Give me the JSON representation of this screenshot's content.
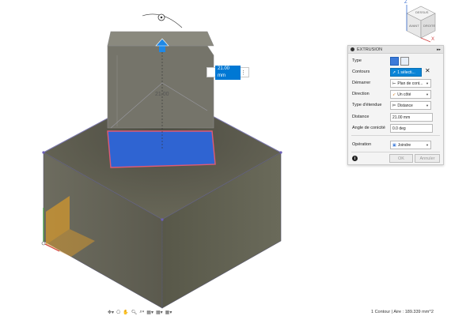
{
  "viewport": {
    "dimension_value": "21.00 mm",
    "dimension_label": "21.00",
    "viewcube": {
      "top": "DESSUS",
      "front": "AVANT",
      "right": "DROITE",
      "axis_x": "X",
      "axis_z": "Z"
    }
  },
  "panel": {
    "title": "EXTRUSION",
    "rows": {
      "type": {
        "label": "Type"
      },
      "profiles": {
        "label": "Contours",
        "value": "1 sélecti..."
      },
      "start": {
        "label": "Démarrer",
        "value": "Plan de cont..."
      },
      "direction": {
        "label": "Direction",
        "value": "Un côté"
      },
      "extent_type": {
        "label": "Type d'étendue",
        "value": "Distance"
      },
      "distance": {
        "label": "Distance",
        "value": "21.00 mm"
      },
      "taper": {
        "label": "Angle de conicité",
        "value": "0.0 deg"
      },
      "operation": {
        "label": "Opération",
        "value": "Joindre"
      }
    },
    "ok_label": "OK",
    "cancel_label": "Annuler",
    "info_symbol": "i"
  },
  "status_bar": {
    "text": "1 Contour | Aire : 189.339 mm^2"
  },
  "colors": {
    "model": "#6b6a5c",
    "profile": "#2f64d2",
    "accent": "#0a84d6"
  }
}
